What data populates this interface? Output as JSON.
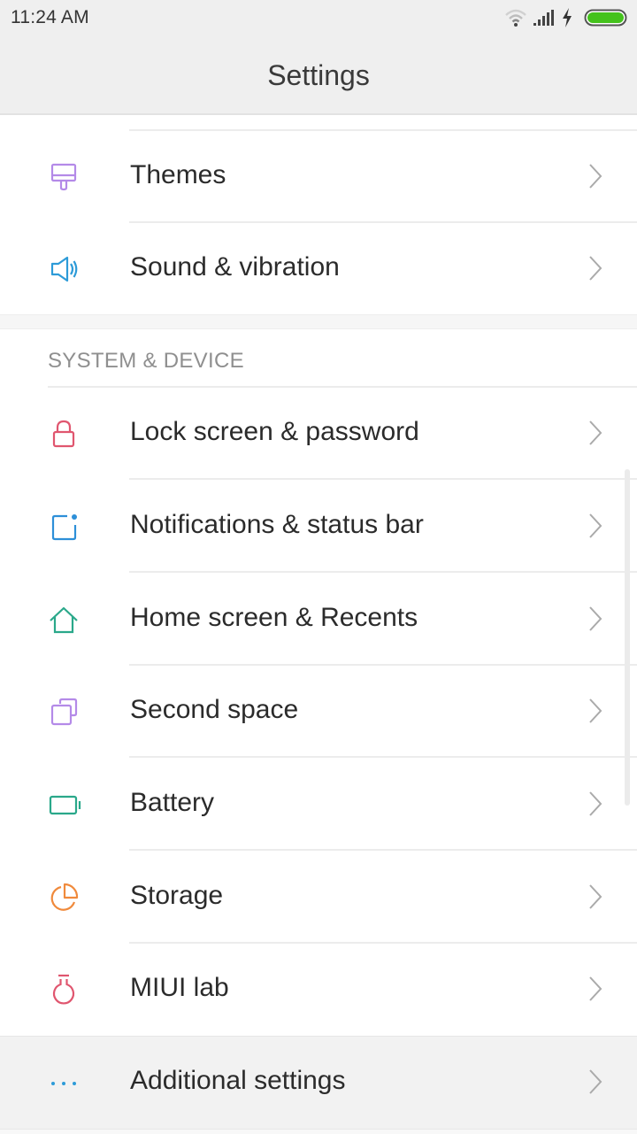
{
  "status_bar": {
    "time": "11:24 AM",
    "icons": [
      "wifi-icon",
      "signal-icon",
      "charging-icon",
      "battery-icon"
    ],
    "battery_color": "#44c21c"
  },
  "header": {
    "title": "Settings"
  },
  "sections": [
    {
      "header": null,
      "items": [
        {
          "label": "Themes",
          "icon": "brush-icon",
          "color": "#b48ae8"
        },
        {
          "label": "Sound & vibration",
          "icon": "speaker-icon",
          "color": "#2d9bd8"
        }
      ]
    },
    {
      "header": "SYSTEM & DEVICE",
      "items": [
        {
          "label": "Lock screen & password",
          "icon": "lock-icon",
          "color": "#e0566f"
        },
        {
          "label": "Notifications & status bar",
          "icon": "notification-icon",
          "color": "#2d8fd8"
        },
        {
          "label": "Home screen & Recents",
          "icon": "home-icon",
          "color": "#2aa88a"
        },
        {
          "label": "Second space",
          "icon": "second-space-icon",
          "color": "#b48ae8"
        },
        {
          "label": "Battery",
          "icon": "battery-item-icon",
          "color": "#2aa88a"
        },
        {
          "label": "Storage",
          "icon": "storage-pie-icon",
          "color": "#f08a3c"
        },
        {
          "label": "MIUI lab",
          "icon": "flask-icon",
          "color": "#e0566f"
        },
        {
          "label": "Additional settings",
          "icon": "more-dots-icon",
          "color": "#2d9bd8"
        }
      ]
    }
  ]
}
